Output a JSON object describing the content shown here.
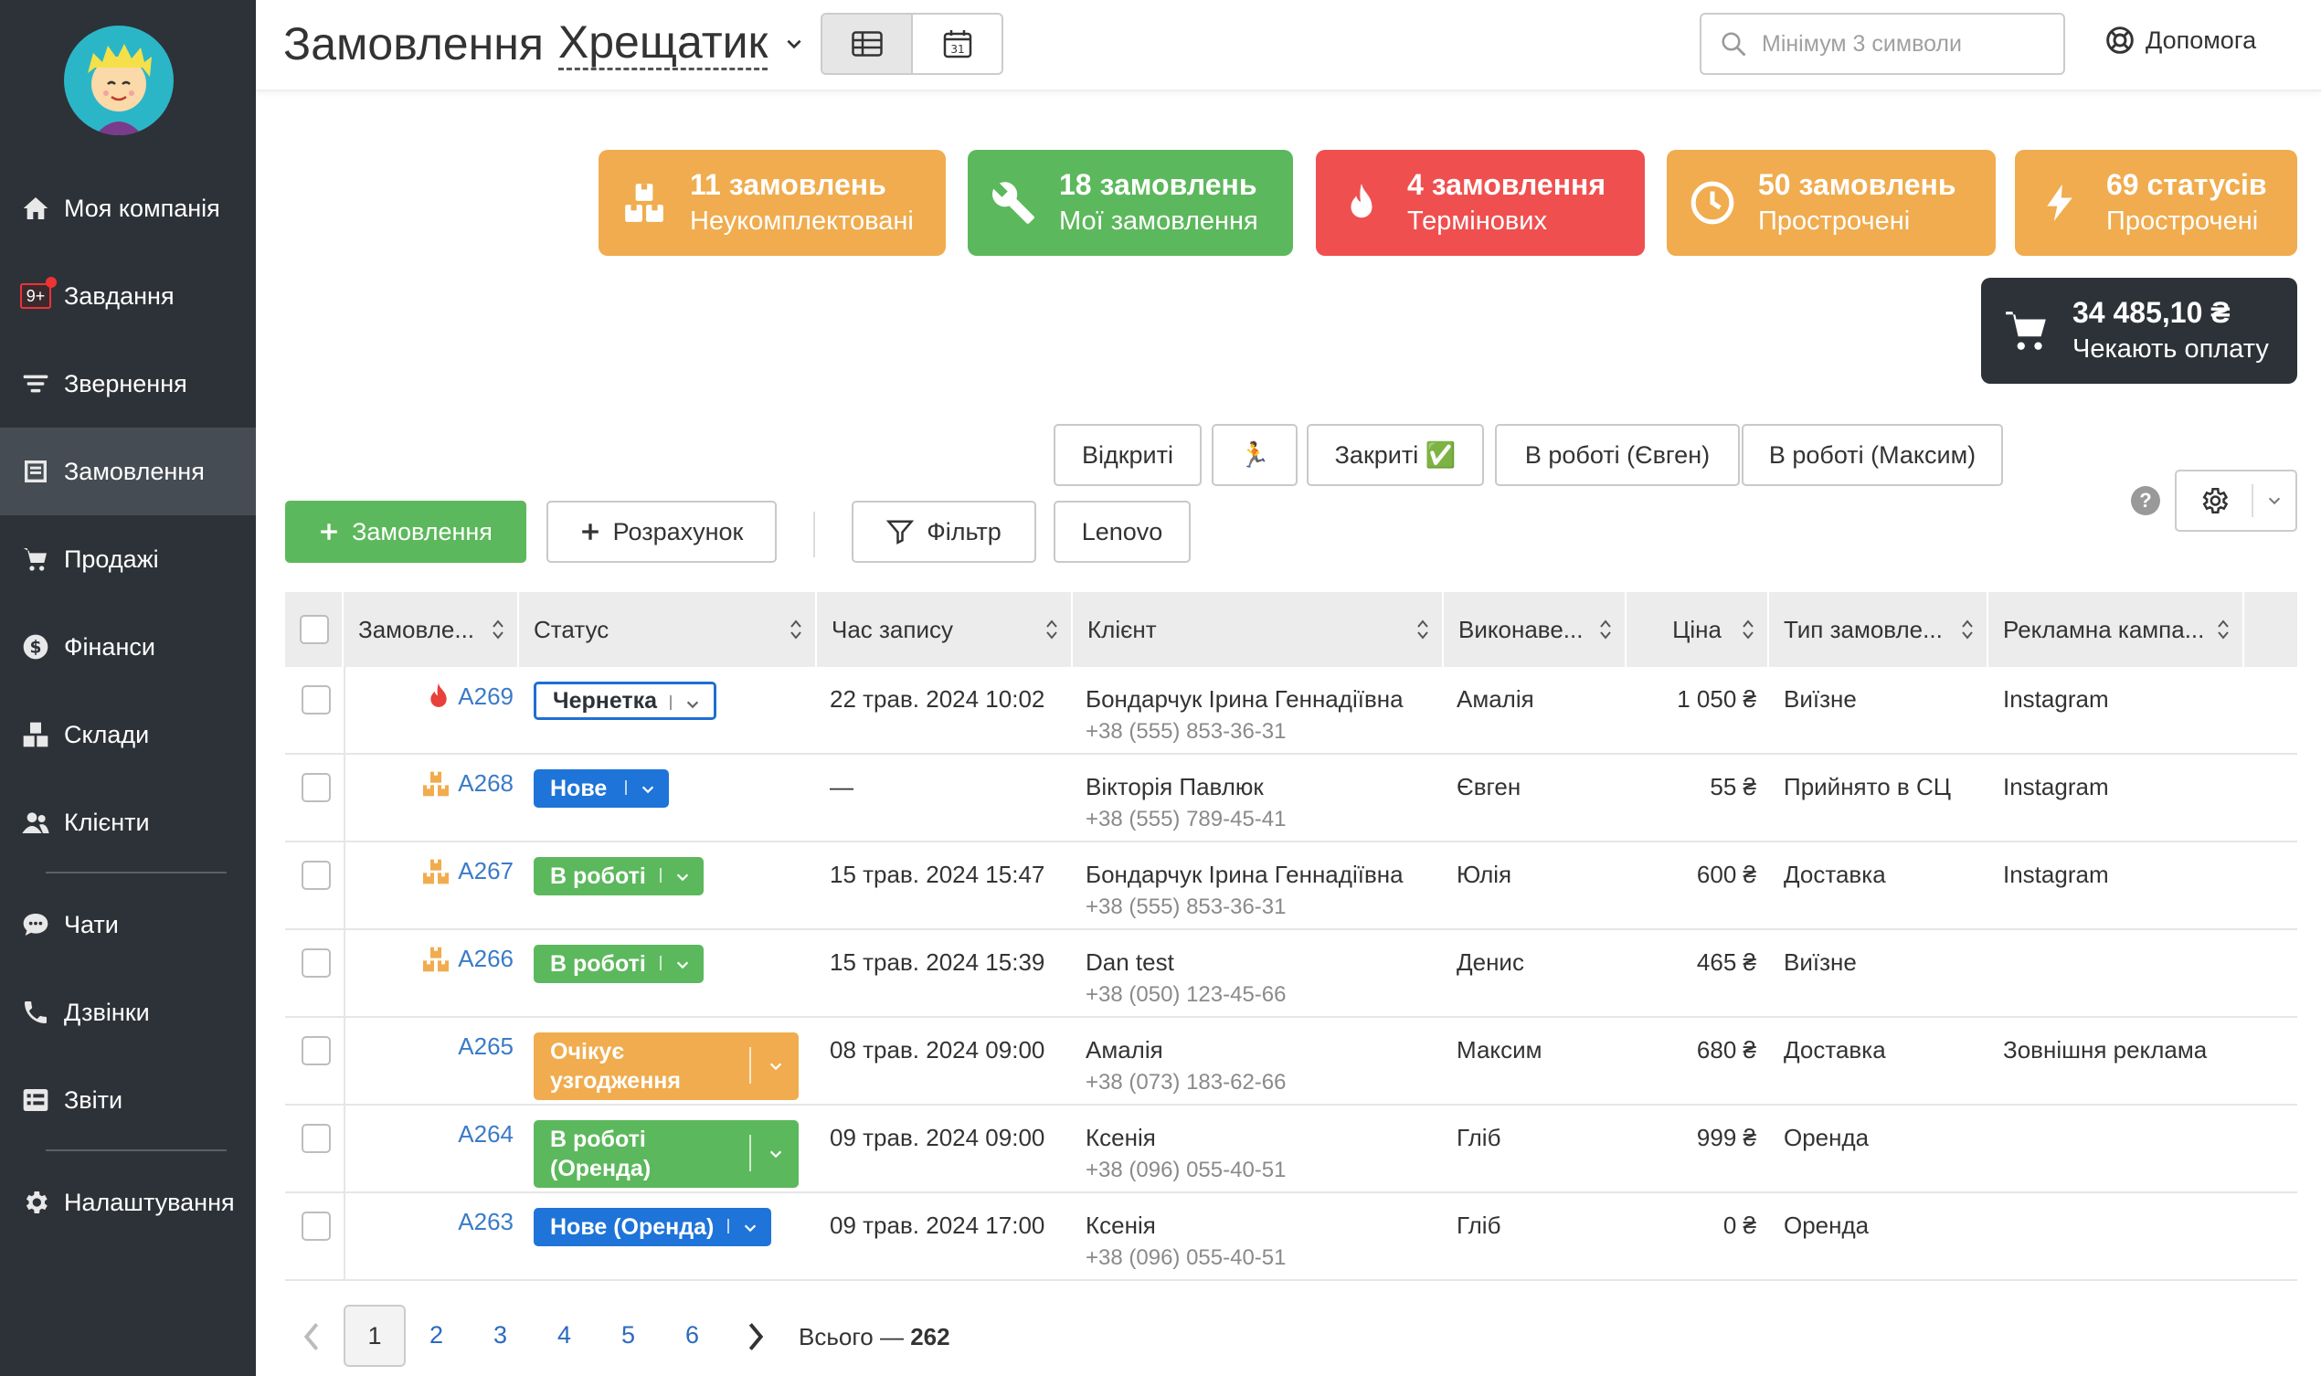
{
  "sidebar": {
    "items": [
      {
        "label": "Моя компанія",
        "icon": "home-icon"
      },
      {
        "label": "Завдання",
        "icon": "tasks-badge-icon",
        "badge": "9+"
      },
      {
        "label": "Звернення",
        "icon": "filter-lines-icon"
      },
      {
        "label": "Замовлення",
        "icon": "orders-icon",
        "active": true
      },
      {
        "label": "Продажі",
        "icon": "cart-icon"
      },
      {
        "label": "Фінанси",
        "icon": "dollar-icon"
      },
      {
        "label": "Склади",
        "icon": "boxes-icon"
      },
      {
        "label": "Клієнти",
        "icon": "users-icon"
      },
      {
        "label": "Чати",
        "icon": "chat-icon"
      },
      {
        "label": "Дзвінки",
        "icon": "phone-icon"
      },
      {
        "label": "Звіти",
        "icon": "reports-icon"
      },
      {
        "label": "Налаштування",
        "icon": "gear-icon"
      }
    ]
  },
  "header": {
    "title": "Замовлення",
    "location": "Хрещатик",
    "calendar_day": "31",
    "search_placeholder": "Мінімум 3 символи",
    "help_label": "Допомога"
  },
  "cards": [
    {
      "count": "11 замовлень",
      "label": "Неукомплектовані",
      "color": "#f0ac4e",
      "icon": "boxes-icon"
    },
    {
      "count": "18 замовлень",
      "label": "Мої замовлення",
      "color": "#5cb85c",
      "icon": "wrench-icon"
    },
    {
      "count": "4 замовлення",
      "label": "Термінових",
      "color": "#f04f4f",
      "icon": "fire-icon"
    },
    {
      "count": "50 замовлень",
      "label": "Прострочені",
      "color": "#f0ac4e",
      "icon": "clock-icon"
    },
    {
      "count": "69 статусів",
      "label": "Прострочені",
      "color": "#f0ac4e",
      "icon": "lightning-icon"
    },
    {
      "count": "34 485,10 ₴",
      "label": "Чекають оплату",
      "color": "#2d3238",
      "icon": "cart-icon"
    }
  ],
  "filters": {
    "chips": [
      "Відкриті",
      "🏃",
      "Закриті ✅",
      "В роботі (Євген)",
      "В роботі (Максим)"
    ],
    "add_order": "Замовлення",
    "add_calc": "Розрахунок",
    "filter": "Фільтр",
    "lenovo": "Lenovo"
  },
  "table": {
    "columns": [
      "Замовле...",
      "Статус",
      "Час запису",
      "Клієнт",
      "Виконаве...",
      "Ціна",
      "Тип замовле...",
      "Рекламна кампа..."
    ],
    "rows": [
      {
        "id": "A269",
        "flag": "fire-icon",
        "status": "Чернетка",
        "status_style": "outline",
        "time": "22 трав. 2024 10:02",
        "client": "Бондарчук Ірина Геннадіївна",
        "phone": "+38 (555) 853-36-31",
        "executor": "Амалія",
        "price": "1 050 ₴",
        "type": "Виїзне",
        "campaign": "Instagram"
      },
      {
        "id": "A268",
        "flag": "boxes-icon",
        "status": "Нове",
        "status_style": "blue",
        "time": "—",
        "client": "Вікторія Павлюк",
        "phone": "+38 (555) 789-45-41",
        "executor": "Євген",
        "price": "55 ₴",
        "type": "Прийнято в СЦ",
        "campaign": "Instagram"
      },
      {
        "id": "A267",
        "flag": "boxes-icon",
        "status": "В роботі",
        "status_style": "green",
        "time": "15 трав. 2024 15:47",
        "client": "Бондарчук Ірина Геннадіївна",
        "phone": "+38 (555) 853-36-31",
        "executor": "Юлія",
        "price": "600 ₴",
        "type": "Доставка",
        "campaign": "Instagram"
      },
      {
        "id": "A266",
        "flag": "boxes-icon",
        "status": "В роботі",
        "status_style": "green",
        "time": "15 трав. 2024 15:39",
        "client": "Dan test",
        "phone": "+38 (050) 123-45-66",
        "executor": "Денис",
        "price": "465 ₴",
        "type": "Виїзне",
        "campaign": ""
      },
      {
        "id": "A265",
        "flag": "",
        "status": "Очікує узгодження",
        "status_line1": "Очікує",
        "status_line2": "узгодження",
        "status_style": "orange",
        "time": "08 трав. 2024 09:00",
        "client": "Амалія",
        "phone": "+38 (073) 183-62-66",
        "executor": "Максим",
        "price": "680 ₴",
        "type": "Доставка",
        "campaign": "Зовнішня реклама"
      },
      {
        "id": "A264",
        "flag": "",
        "status": "В роботі (Оренда)",
        "status_line1": "В роботі",
        "status_line2": "(Оренда)",
        "status_style": "green",
        "time": "09 трав. 2024 09:00",
        "client": "Ксенія",
        "phone": "+38 (096) 055-40-51",
        "executor": "Гліб",
        "price": "999 ₴",
        "type": "Оренда",
        "campaign": ""
      },
      {
        "id": "A263",
        "flag": "",
        "status": "Нове (Оренда)",
        "status_style": "blue",
        "time": "09 трав. 2024 17:00",
        "client": "Ксенія",
        "phone": "+38 (096) 055-40-51",
        "executor": "Гліб",
        "price": "0 ₴",
        "type": "Оренда",
        "campaign": ""
      }
    ]
  },
  "pagination": {
    "pages": [
      "1",
      "2",
      "3",
      "4",
      "5",
      "6"
    ],
    "current": "1",
    "total_label": "Всього —",
    "total": "262"
  }
}
